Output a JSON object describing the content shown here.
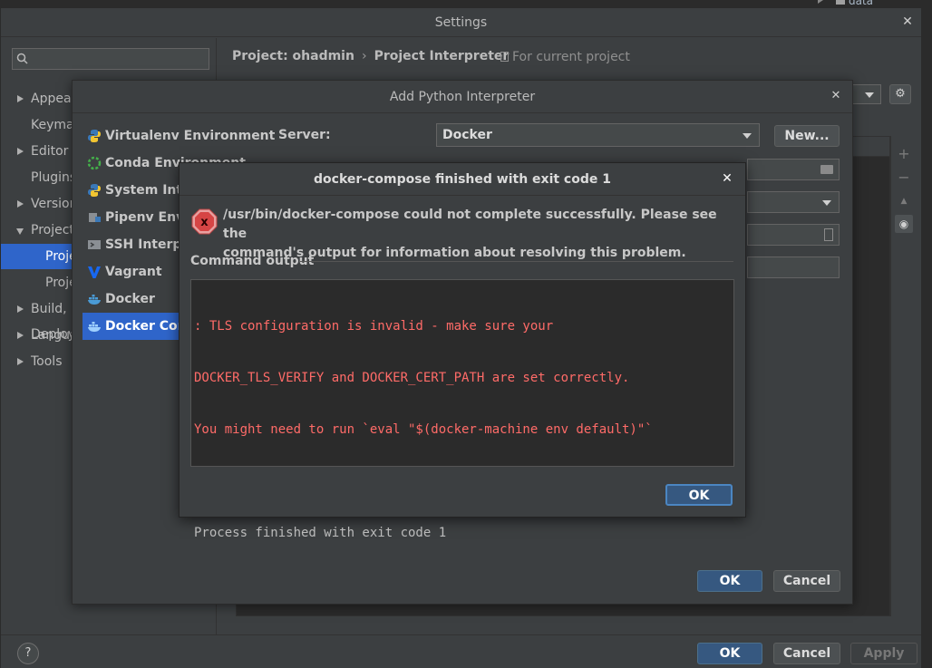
{
  "background": {
    "tree_folder_label": "data"
  },
  "settings": {
    "title": "Settings",
    "close_glyph": "✕",
    "search": {
      "placeholder": "",
      "icon": "search-icon"
    },
    "tree": [
      {
        "label": "Appearance",
        "expandable": true,
        "expanded": false
      },
      {
        "label": "Keymap",
        "expandable": false
      },
      {
        "label": "Editor",
        "expandable": true,
        "expanded": false
      },
      {
        "label": "Plugins",
        "expandable": false
      },
      {
        "label": "Version Control",
        "expandable": true,
        "expanded": false
      },
      {
        "label": "Project: ohadmin",
        "expandable": true,
        "expanded": true
      },
      {
        "label": "Project Interpreter",
        "child": true,
        "selected": true
      },
      {
        "label": "Project Structure",
        "child": true
      },
      {
        "label": "Build, Execution, Deployment",
        "expandable": true,
        "expanded": false
      },
      {
        "label": "Languages & Frameworks",
        "expandable": true,
        "expanded": false
      },
      {
        "label": "Tools",
        "expandable": true,
        "expanded": false
      }
    ],
    "breadcrumb": {
      "project": "Project: ohadmin",
      "separator": "›",
      "page": "Project Interpreter"
    },
    "for_current_project": "For current project",
    "help_label": "?",
    "footer": {
      "ok": "OK",
      "cancel": "Cancel",
      "apply": "Apply"
    },
    "toolbar": {
      "add": "+",
      "remove": "−",
      "up": "▲",
      "eye": "◉"
    }
  },
  "add_interpreter": {
    "title": "Add Python Interpreter",
    "close_glyph": "✕",
    "env_types": [
      {
        "label": "Virtualenv Environment",
        "icon": "python-icon"
      },
      {
        "label": "Conda Environment",
        "icon": "conda-icon"
      },
      {
        "label": "System Interpreter",
        "icon": "python-icon"
      },
      {
        "label": "Pipenv Environment",
        "icon": "pipenv-icon"
      },
      {
        "label": "SSH Interpreter",
        "icon": "ssh-icon"
      },
      {
        "label": "Vagrant",
        "icon": "vagrant-icon"
      },
      {
        "label": "Docker",
        "icon": "docker-icon"
      },
      {
        "label": "Docker Compose",
        "icon": "docker-compose-icon",
        "selected": true
      }
    ],
    "server_label": "Server:",
    "server_value": "Docker",
    "new_button": "New...",
    "ok": "OK",
    "cancel": "Cancel"
  },
  "error_dialog": {
    "title": "docker-compose finished with exit code 1",
    "close_glyph": "✕",
    "message_line1": "/usr/bin/docker-compose could not complete successfully. Please see the",
    "message_line2": "command's output for information about resolving this problem.",
    "command_output_label": "Command output",
    "output": {
      "error_lines": [
        ": TLS configuration is invalid - make sure your",
        "DOCKER_TLS_VERIFY and DOCKER_CERT_PATH are set correctly.",
        "You might need to run `eval \"$(docker-machine env default)\"`"
      ],
      "result_line": "Process finished with exit code 1"
    },
    "ok": "OK"
  },
  "colors": {
    "window_bg": "#3c3f41",
    "selection": "#2f65ca",
    "primary_button": "#365880",
    "error_text": "#ff6b68",
    "error_icon": "#e05555"
  }
}
